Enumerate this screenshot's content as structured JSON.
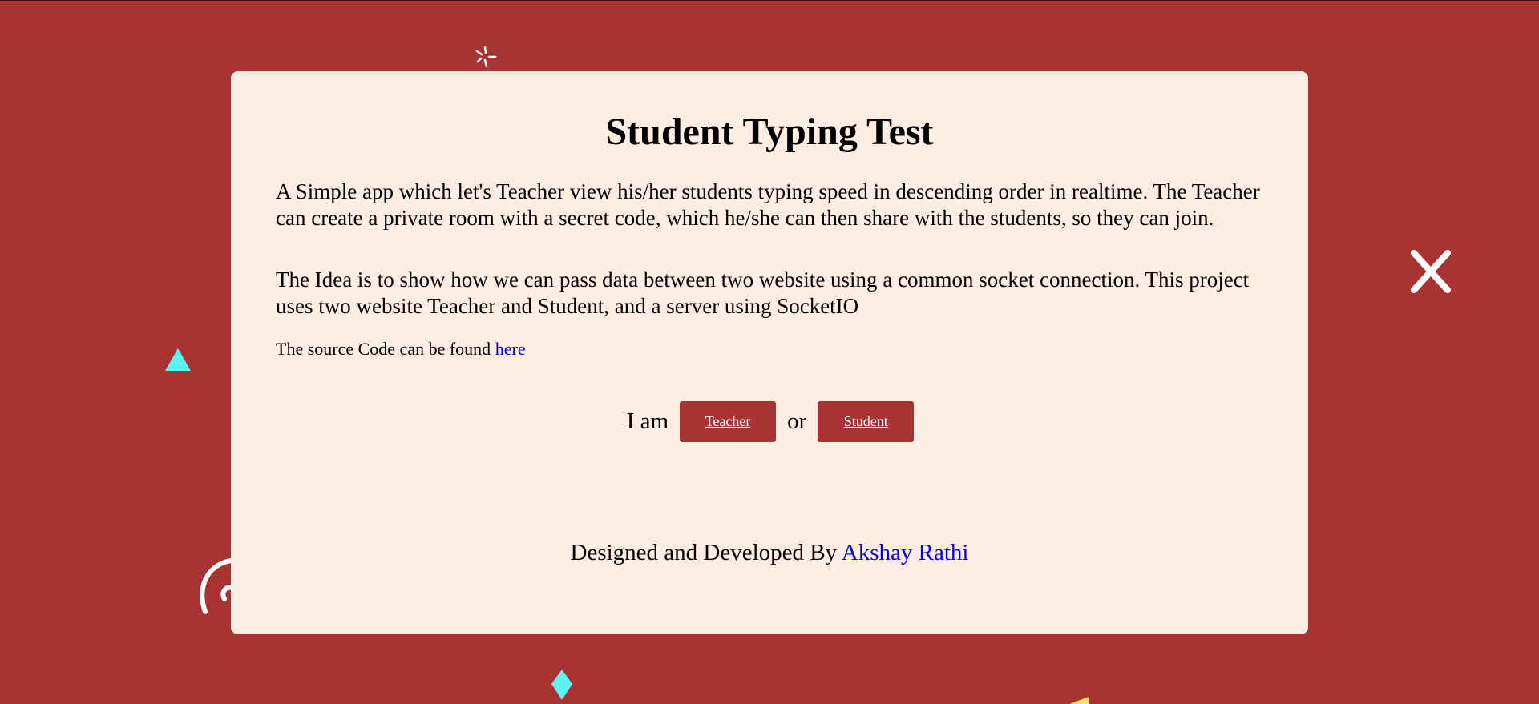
{
  "header": {
    "title": "Student Typing Test"
  },
  "description": {
    "paragraph_1": "A Simple app which let's Teacher view his/her students typing speed in descending order in realtime. The Teacher can create a private room with a secret code, which he/she can then share with the students, so they can join.",
    "paragraph_2": "The Idea is to show how we can pass data between two website using a common socket connection. This project uses two website Teacher and Student, and a server using SocketIO"
  },
  "source": {
    "prefix": "The source Code can be found ",
    "link_text": "here"
  },
  "role": {
    "prefix": "I am",
    "separator": "or",
    "teacher_label": "Teacher",
    "student_label": "Student"
  },
  "footer": {
    "prefix": "Designed and Developed By ",
    "author": "Akshay Rathi"
  },
  "colors": {
    "background": "#a93233",
    "card": "#feede2",
    "link": "#0000ee",
    "button": "#a93233"
  }
}
